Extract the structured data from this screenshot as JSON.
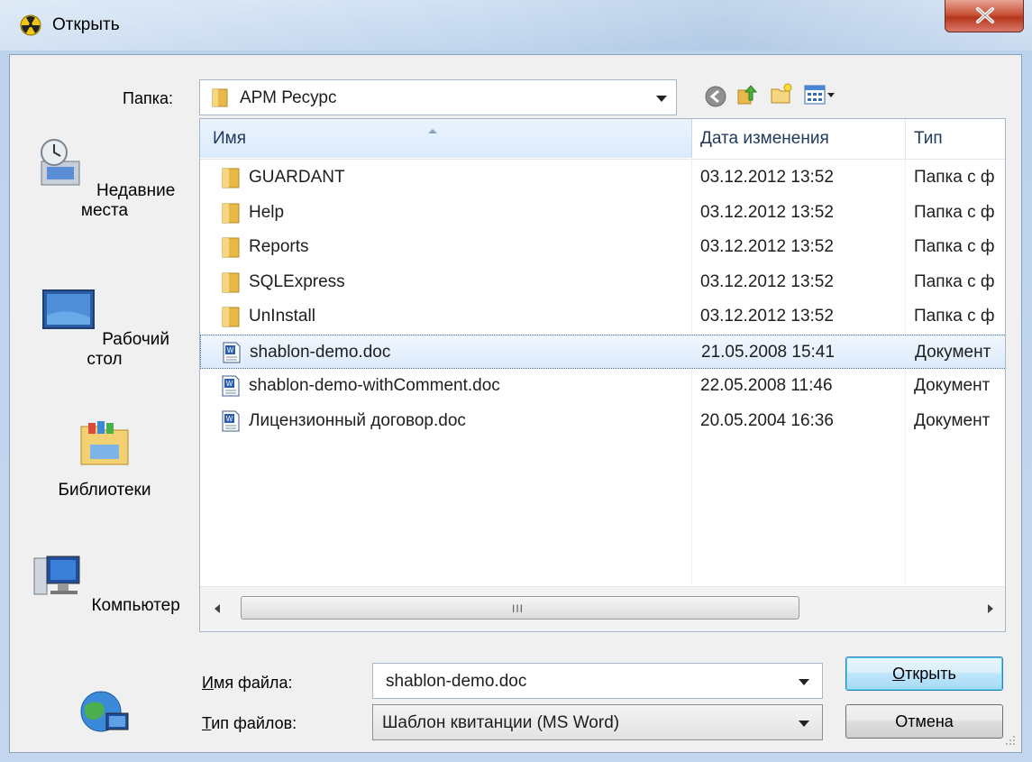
{
  "window": {
    "title": "Открыть"
  },
  "toolbar": {
    "folder_label": "Папка:",
    "folder_value": "АРМ Ресурс"
  },
  "places": [
    {
      "label": "Недавние места",
      "icon": "recent-places-icon"
    },
    {
      "label": "Рабочий стол",
      "icon": "desktop-icon"
    },
    {
      "label": "Библиотеки",
      "icon": "libraries-icon"
    },
    {
      "label": "Компьютер",
      "icon": "computer-icon"
    },
    {
      "label": "",
      "icon": "network-icon"
    }
  ],
  "columns": {
    "name": "Имя",
    "date": "Дата изменения",
    "type": "Тип"
  },
  "files": [
    {
      "name": "GUARDANT",
      "date": "03.12.2012 13:52",
      "type": "Папка с ф",
      "icon": "folder-icon",
      "selected": false
    },
    {
      "name": "Help",
      "date": "03.12.2012 13:52",
      "type": "Папка с ф",
      "icon": "folder-icon",
      "selected": false
    },
    {
      "name": "Reports",
      "date": "03.12.2012 13:52",
      "type": "Папка с ф",
      "icon": "folder-icon",
      "selected": false
    },
    {
      "name": "SQLExpress",
      "date": "03.12.2012 13:52",
      "type": "Папка с ф",
      "icon": "folder-icon",
      "selected": false
    },
    {
      "name": "UnInstall",
      "date": "03.12.2012 13:52",
      "type": "Папка с ф",
      "icon": "folder-icon",
      "selected": false
    },
    {
      "name": "shablon-demo.doc",
      "date": "21.05.2008 15:41",
      "type": "Документ",
      "icon": "word-doc-icon",
      "selected": true
    },
    {
      "name": "shablon-demo-withComment.doc",
      "date": "22.05.2008 11:46",
      "type": "Документ",
      "icon": "word-doc-icon",
      "selected": false
    },
    {
      "name": "Лицензионный договор.doc",
      "date": "20.05.2004 16:36",
      "type": "Документ",
      "icon": "word-doc-icon",
      "selected": false
    }
  ],
  "scrollbar": {
    "grip": "III"
  },
  "filename": {
    "label_prefix": "",
    "label_u": "И",
    "label_rest": "мя файла:",
    "value": "shablon-demo.doc"
  },
  "filetype": {
    "label_u": "Т",
    "label_rest": "ип файлов:",
    "value": "Шаблон квитанции (MS Word)"
  },
  "buttons": {
    "open_u": "О",
    "open_rest": "ткрыть",
    "cancel": "Отмена"
  },
  "colors": {
    "selection": "#dceafc",
    "accent": "#3d6fb4",
    "close": "#c9553a"
  }
}
